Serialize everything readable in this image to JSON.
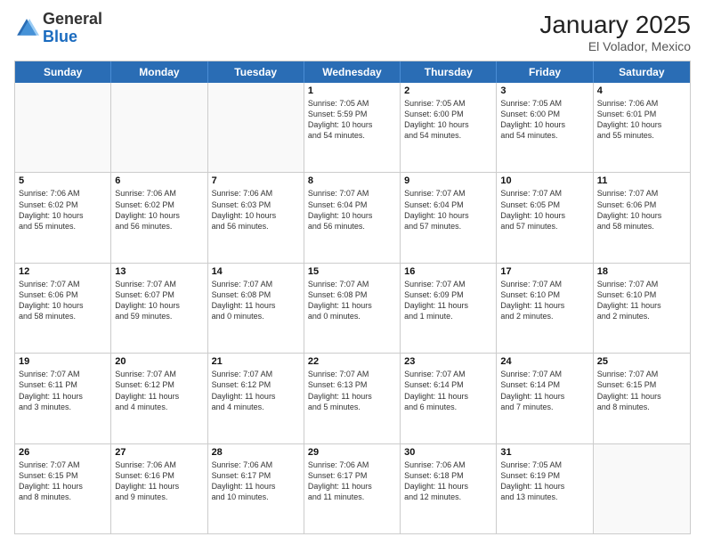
{
  "logo": {
    "general": "General",
    "blue": "Blue"
  },
  "header": {
    "title": "January 2025",
    "subtitle": "El Volador, Mexico"
  },
  "days_of_week": [
    "Sunday",
    "Monday",
    "Tuesday",
    "Wednesday",
    "Thursday",
    "Friday",
    "Saturday"
  ],
  "weeks": [
    [
      {
        "day": "",
        "info": "",
        "empty": true
      },
      {
        "day": "",
        "info": "",
        "empty": true
      },
      {
        "day": "",
        "info": "",
        "empty": true
      },
      {
        "day": "1",
        "info": "Sunrise: 7:05 AM\nSunset: 5:59 PM\nDaylight: 10 hours\nand 54 minutes."
      },
      {
        "day": "2",
        "info": "Sunrise: 7:05 AM\nSunset: 6:00 PM\nDaylight: 10 hours\nand 54 minutes."
      },
      {
        "day": "3",
        "info": "Sunrise: 7:05 AM\nSunset: 6:00 PM\nDaylight: 10 hours\nand 54 minutes."
      },
      {
        "day": "4",
        "info": "Sunrise: 7:06 AM\nSunset: 6:01 PM\nDaylight: 10 hours\nand 55 minutes."
      }
    ],
    [
      {
        "day": "5",
        "info": "Sunrise: 7:06 AM\nSunset: 6:02 PM\nDaylight: 10 hours\nand 55 minutes."
      },
      {
        "day": "6",
        "info": "Sunrise: 7:06 AM\nSunset: 6:02 PM\nDaylight: 10 hours\nand 56 minutes."
      },
      {
        "day": "7",
        "info": "Sunrise: 7:06 AM\nSunset: 6:03 PM\nDaylight: 10 hours\nand 56 minutes."
      },
      {
        "day": "8",
        "info": "Sunrise: 7:07 AM\nSunset: 6:04 PM\nDaylight: 10 hours\nand 56 minutes."
      },
      {
        "day": "9",
        "info": "Sunrise: 7:07 AM\nSunset: 6:04 PM\nDaylight: 10 hours\nand 57 minutes."
      },
      {
        "day": "10",
        "info": "Sunrise: 7:07 AM\nSunset: 6:05 PM\nDaylight: 10 hours\nand 57 minutes."
      },
      {
        "day": "11",
        "info": "Sunrise: 7:07 AM\nSunset: 6:06 PM\nDaylight: 10 hours\nand 58 minutes."
      }
    ],
    [
      {
        "day": "12",
        "info": "Sunrise: 7:07 AM\nSunset: 6:06 PM\nDaylight: 10 hours\nand 58 minutes."
      },
      {
        "day": "13",
        "info": "Sunrise: 7:07 AM\nSunset: 6:07 PM\nDaylight: 10 hours\nand 59 minutes."
      },
      {
        "day": "14",
        "info": "Sunrise: 7:07 AM\nSunset: 6:08 PM\nDaylight: 11 hours\nand 0 minutes."
      },
      {
        "day": "15",
        "info": "Sunrise: 7:07 AM\nSunset: 6:08 PM\nDaylight: 11 hours\nand 0 minutes."
      },
      {
        "day": "16",
        "info": "Sunrise: 7:07 AM\nSunset: 6:09 PM\nDaylight: 11 hours\nand 1 minute."
      },
      {
        "day": "17",
        "info": "Sunrise: 7:07 AM\nSunset: 6:10 PM\nDaylight: 11 hours\nand 2 minutes."
      },
      {
        "day": "18",
        "info": "Sunrise: 7:07 AM\nSunset: 6:10 PM\nDaylight: 11 hours\nand 2 minutes."
      }
    ],
    [
      {
        "day": "19",
        "info": "Sunrise: 7:07 AM\nSunset: 6:11 PM\nDaylight: 11 hours\nand 3 minutes."
      },
      {
        "day": "20",
        "info": "Sunrise: 7:07 AM\nSunset: 6:12 PM\nDaylight: 11 hours\nand 4 minutes."
      },
      {
        "day": "21",
        "info": "Sunrise: 7:07 AM\nSunset: 6:12 PM\nDaylight: 11 hours\nand 4 minutes."
      },
      {
        "day": "22",
        "info": "Sunrise: 7:07 AM\nSunset: 6:13 PM\nDaylight: 11 hours\nand 5 minutes."
      },
      {
        "day": "23",
        "info": "Sunrise: 7:07 AM\nSunset: 6:14 PM\nDaylight: 11 hours\nand 6 minutes."
      },
      {
        "day": "24",
        "info": "Sunrise: 7:07 AM\nSunset: 6:14 PM\nDaylight: 11 hours\nand 7 minutes."
      },
      {
        "day": "25",
        "info": "Sunrise: 7:07 AM\nSunset: 6:15 PM\nDaylight: 11 hours\nand 8 minutes."
      }
    ],
    [
      {
        "day": "26",
        "info": "Sunrise: 7:07 AM\nSunset: 6:15 PM\nDaylight: 11 hours\nand 8 minutes."
      },
      {
        "day": "27",
        "info": "Sunrise: 7:06 AM\nSunset: 6:16 PM\nDaylight: 11 hours\nand 9 minutes."
      },
      {
        "day": "28",
        "info": "Sunrise: 7:06 AM\nSunset: 6:17 PM\nDaylight: 11 hours\nand 10 minutes."
      },
      {
        "day": "29",
        "info": "Sunrise: 7:06 AM\nSunset: 6:17 PM\nDaylight: 11 hours\nand 11 minutes."
      },
      {
        "day": "30",
        "info": "Sunrise: 7:06 AM\nSunset: 6:18 PM\nDaylight: 11 hours\nand 12 minutes."
      },
      {
        "day": "31",
        "info": "Sunrise: 7:05 AM\nSunset: 6:19 PM\nDaylight: 11 hours\nand 13 minutes."
      },
      {
        "day": "",
        "info": "",
        "empty": true
      }
    ]
  ]
}
